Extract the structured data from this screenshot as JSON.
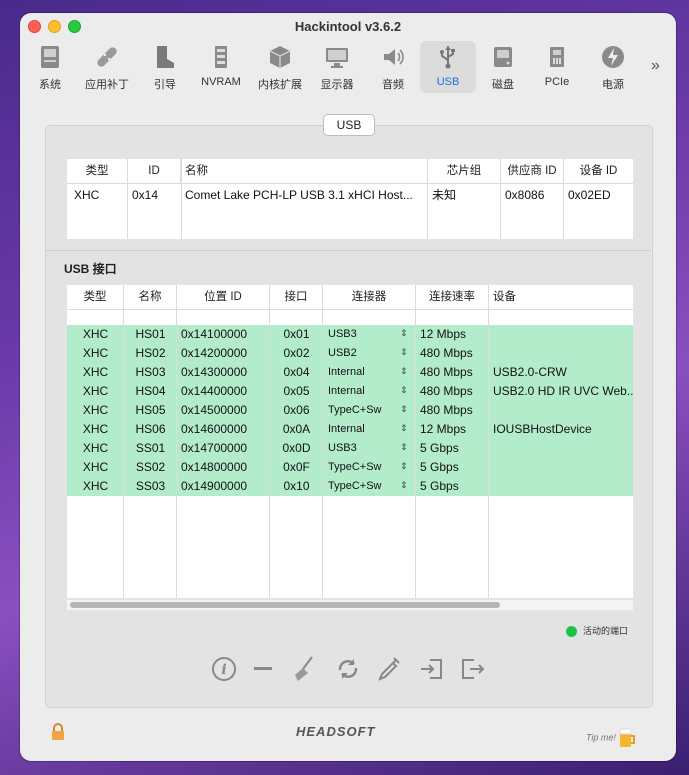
{
  "app": {
    "title": "Hackintool v3.6.2"
  },
  "toolbar": {
    "items": [
      {
        "label": "系统",
        "icon": "system-icon"
      },
      {
        "label": "应用补丁",
        "icon": "patch-icon"
      },
      {
        "label": "引导",
        "icon": "boot-icon"
      },
      {
        "label": "NVRAM",
        "icon": "nvram-icon"
      },
      {
        "label": "内核扩展",
        "icon": "kext-icon"
      },
      {
        "label": "显示器",
        "icon": "display-icon"
      },
      {
        "label": "音频",
        "icon": "audio-icon"
      },
      {
        "label": "USB",
        "icon": "usb-icon"
      },
      {
        "label": "磁盘",
        "icon": "disk-icon"
      },
      {
        "label": "PCIe",
        "icon": "pcie-icon"
      },
      {
        "label": "电源",
        "icon": "power-icon"
      }
    ],
    "selected": "USB",
    "more": "»"
  },
  "tab": {
    "label": "USB"
  },
  "controllers": {
    "columns": [
      "类型",
      "ID",
      "名称",
      "芯片组",
      "供应商 ID",
      "设备 ID"
    ],
    "rows": [
      {
        "type": "XHC",
        "id": "0x14",
        "name": "Comet Lake PCH-LP USB 3.1 xHCI Host...",
        "chipset": "未知",
        "vendor": "0x8086",
        "device": "0x02ED"
      }
    ]
  },
  "ports": {
    "title": "USB 接口",
    "columns": [
      "类型",
      "名称",
      "位置 ID",
      "接口",
      "连接器",
      "连接速率",
      "设备"
    ],
    "rows": [
      {
        "type": "XHC",
        "name": "HS01",
        "loc": "0x14100000",
        "port": "0x01",
        "conn": "USB3",
        "speed": "12 Mbps",
        "device": ""
      },
      {
        "type": "XHC",
        "name": "HS02",
        "loc": "0x14200000",
        "port": "0x02",
        "conn": "USB2",
        "speed": "480 Mbps",
        "device": ""
      },
      {
        "type": "XHC",
        "name": "HS03",
        "loc": "0x14300000",
        "port": "0x04",
        "conn": "Internal",
        "speed": "480 Mbps",
        "device": "USB2.0-CRW"
      },
      {
        "type": "XHC",
        "name": "HS04",
        "loc": "0x14400000",
        "port": "0x05",
        "conn": "Internal",
        "speed": "480 Mbps",
        "device": "USB2.0 HD IR UVC Web..."
      },
      {
        "type": "XHC",
        "name": "HS05",
        "loc": "0x14500000",
        "port": "0x06",
        "conn": "TypeC+Sw",
        "speed": "480 Mbps",
        "device": ""
      },
      {
        "type": "XHC",
        "name": "HS06",
        "loc": "0x14600000",
        "port": "0x0A",
        "conn": "Internal",
        "speed": "12 Mbps",
        "device": "IOUSBHostDevice"
      },
      {
        "type": "XHC",
        "name": "SS01",
        "loc": "0x14700000",
        "port": "0x0D",
        "conn": "USB3",
        "speed": "5 Gbps",
        "device": ""
      },
      {
        "type": "XHC",
        "name": "SS02",
        "loc": "0x14800000",
        "port": "0x0F",
        "conn": "TypeC+Sw",
        "speed": "5 Gbps",
        "device": ""
      },
      {
        "type": "XHC",
        "name": "SS03",
        "loc": "0x14900000",
        "port": "0x10",
        "conn": "TypeC+Sw",
        "speed": "5 Gbps",
        "device": ""
      }
    ]
  },
  "legend": {
    "label": "活动的端口",
    "color": "#1ec24a"
  },
  "row_active_color": "#b3eccb",
  "accent": "#1a6fe0",
  "footer": {
    "brand": "HEADSOFT",
    "tip": "Tip me!"
  }
}
